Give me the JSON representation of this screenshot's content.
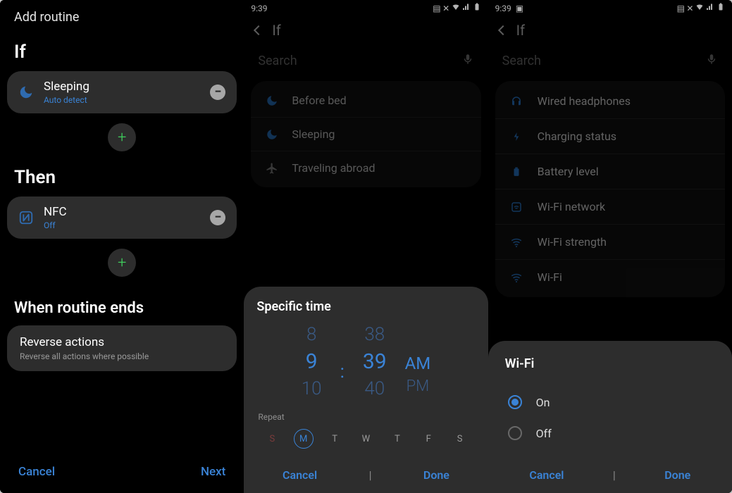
{
  "panel1": {
    "title": "Add routine",
    "if_heading": "If",
    "if_card": {
      "title": "Sleeping",
      "subtitle": "Auto detect"
    },
    "then_heading": "Then",
    "then_card": {
      "title": "NFC",
      "subtitle": "Off"
    },
    "end_heading": "When routine ends",
    "reverse": {
      "title": "Reverse actions",
      "subtitle": "Reverse all actions where possible"
    },
    "footer": {
      "cancel": "Cancel",
      "next": "Next"
    }
  },
  "panel2": {
    "time": "9:39",
    "header": "If",
    "search_placeholder": "Search",
    "dim_items": {
      "a": "Before bed",
      "b": "Sleeping",
      "c": "Traveling abroad"
    },
    "sheet": {
      "title": "Specific time",
      "hour_prev": "8",
      "hour": "9",
      "hour_next": "10",
      "min_prev": "38",
      "min": "39",
      "min_next": "40",
      "ampm": "AM",
      "ampm_alt": "PM",
      "repeat_label": "Repeat",
      "days": {
        "sun": "S",
        "mon": "M",
        "tue": "T",
        "wed": "W",
        "thu": "T",
        "fri": "F",
        "sat": "S"
      },
      "cancel": "Cancel",
      "done": "Done"
    }
  },
  "panel3": {
    "time": "9:39",
    "header": "If",
    "search_placeholder": "Search",
    "items": {
      "a": "Wired headphones",
      "b": "Charging status",
      "c": "Battery level",
      "d": "Wi-Fi network",
      "e": "Wi-Fi strength",
      "f": "Wi-Fi"
    },
    "sheet": {
      "title": "Wi-Fi",
      "on": "On",
      "off": "Off",
      "cancel": "Cancel",
      "done": "Done"
    }
  }
}
